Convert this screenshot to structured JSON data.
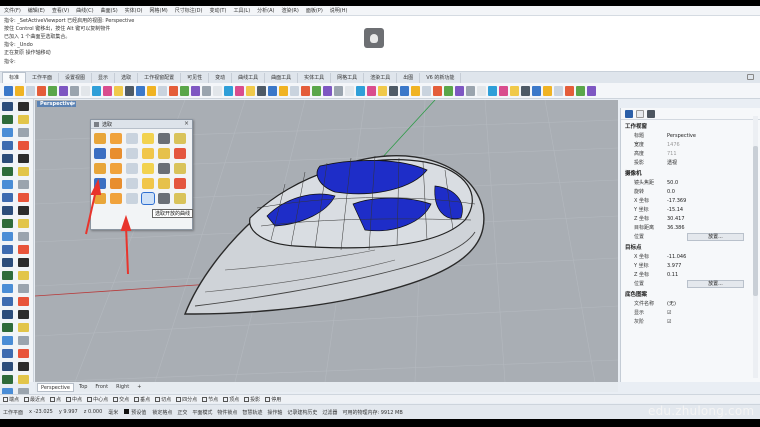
{
  "menu": [
    "文件(F)",
    "编辑(E)",
    "查看(V)",
    "曲线(C)",
    "曲面(S)",
    "实体(O)",
    "网格(M)",
    "尺寸标注(D)",
    "变动(T)",
    "工具(L)",
    "分析(A)",
    "渲染(R)",
    "面板(P)",
    "说明(H)"
  ],
  "command_history": [
    "指令: _SetActiveViewport 已经启用的视图: Perspective",
    "按住 Control 键移出，按住 Alt 键可以复制物件",
    "已加入 1 个曲面至选取集合。",
    "指令: _Undo",
    "正在复原 操作轴移动",
    "指令:"
  ],
  "tabs": [
    "标准",
    "工作平面",
    "设置视图",
    "显示",
    "选取",
    "工作视窗配置",
    "可见性",
    "变动",
    "曲线工具",
    "曲面工具",
    "实体工具",
    "网格工具",
    "渲染工具",
    "出图",
    "V6 的新功能"
  ],
  "active_tab": "标准",
  "viewport": {
    "title": "Perspective"
  },
  "palette": {
    "title": "选取",
    "close": "×"
  },
  "tooltip": "选取开放的曲线",
  "viewport_tabs": [
    "Perspective",
    "Top",
    "Front",
    "Right",
    "+"
  ],
  "properties": {
    "sections": {
      "viewport": "工作视窗",
      "camera": "摄像机",
      "target": "目标点",
      "wallpaper": "底色图案"
    },
    "viewport_rows": [
      {
        "k": "标题",
        "v": "Perspective",
        "dim": false
      },
      {
        "k": "宽度",
        "v": "1476",
        "dim": true
      },
      {
        "k": "高度",
        "v": "711",
        "dim": true
      },
      {
        "k": "投影",
        "v": "透视",
        "dim": false
      }
    ],
    "camera_rows": [
      {
        "k": "镜头焦距",
        "v": "50.0"
      },
      {
        "k": "旋转",
        "v": "0.0"
      },
      {
        "k": "X 坐标",
        "v": "-17.369"
      },
      {
        "k": "Y 坐标",
        "v": "-15.14"
      },
      {
        "k": "Z 坐标",
        "v": "30.417"
      },
      {
        "k": "目标距离",
        "v": "36.386"
      }
    ],
    "camera_position_label": "位置",
    "camera_position_button": "放置...",
    "target_rows": [
      {
        "k": "X 坐标",
        "v": "-11.046"
      },
      {
        "k": "Y 坐标",
        "v": "3.977"
      },
      {
        "k": "Z 坐标",
        "v": "0.11"
      }
    ],
    "target_position_label": "位置",
    "target_position_button": "放置...",
    "wallpaper_rows": [
      {
        "k": "文件名称",
        "v": "(无)"
      },
      {
        "k": "显示",
        "v": "☑"
      },
      {
        "k": "灰阶",
        "v": "☑"
      }
    ]
  },
  "osnaps": [
    "端点",
    "最近点",
    "点",
    "中点",
    "中心点",
    "交点",
    "垂点",
    "切点",
    "四分点",
    "节点",
    "顶点",
    "投影",
    "停用"
  ],
  "status": {
    "plane": "工作平面",
    "x": "x -23.025",
    "y": "y 9.997",
    "z": "z 0.000",
    "units": "毫米",
    "layer": "预设值",
    "modes": [
      "锁定格点",
      "正交",
      "平面模式",
      "物件锁点",
      "智慧轨迹",
      "操作轴",
      "记录建构历史",
      "过滤器",
      "可用的物理内存: 9912 MB"
    ]
  },
  "watermark": "edu.zhulong.com",
  "colors": {
    "accent": "#5a82b4",
    "model_blue": "#1e2dc8",
    "grid": "#a9aeb4",
    "axis_red": "#b83a3a",
    "axis_green": "#2e9b47"
  }
}
